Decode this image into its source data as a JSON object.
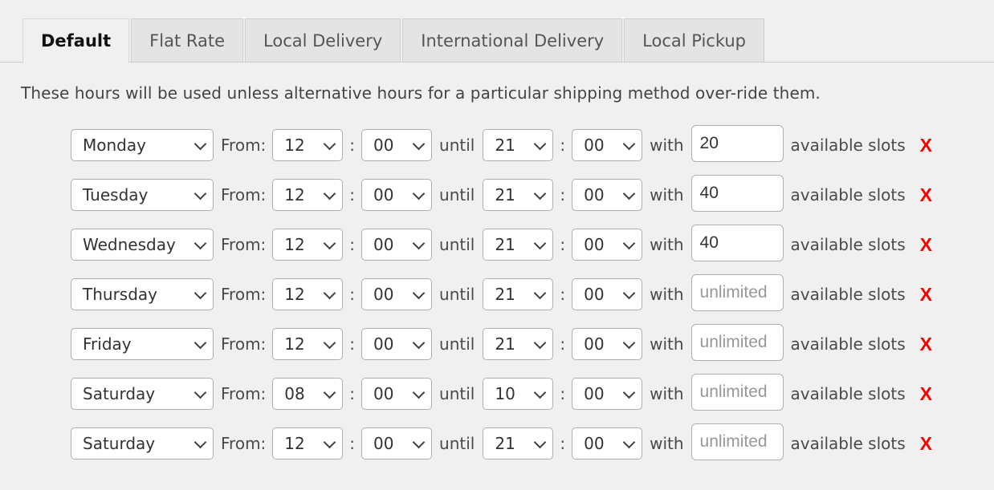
{
  "tabs": [
    {
      "label": "Default",
      "active": true
    },
    {
      "label": "Flat Rate",
      "active": false
    },
    {
      "label": "Local Delivery",
      "active": false
    },
    {
      "label": "International Delivery",
      "active": false
    },
    {
      "label": "Local Pickup",
      "active": false
    }
  ],
  "description": "These hours will be used unless alternative hours for a particular shipping method over-ride them.",
  "labels": {
    "from": "From:",
    "colon": ":",
    "until": "until",
    "with": "with",
    "available_slots": "available slots",
    "remove": "X"
  },
  "slots_placeholder": "unlimited",
  "colors": {
    "remove": "#fb0000",
    "page_bg": "#f0f0f0",
    "tab_inactive_bg": "#e4e4e4",
    "control_border": "#a9b0b7"
  },
  "rows": [
    {
      "day": "Monday",
      "from_hour": "12",
      "from_min": "00",
      "until_hour": "21",
      "until_min": "00",
      "slots": "20"
    },
    {
      "day": "Tuesday",
      "from_hour": "12",
      "from_min": "00",
      "until_hour": "21",
      "until_min": "00",
      "slots": "40"
    },
    {
      "day": "Wednesday",
      "from_hour": "12",
      "from_min": "00",
      "until_hour": "21",
      "until_min": "00",
      "slots": "40"
    },
    {
      "day": "Thursday",
      "from_hour": "12",
      "from_min": "00",
      "until_hour": "21",
      "until_min": "00",
      "slots": ""
    },
    {
      "day": "Friday",
      "from_hour": "12",
      "from_min": "00",
      "until_hour": "21",
      "until_min": "00",
      "slots": ""
    },
    {
      "day": "Saturday",
      "from_hour": "08",
      "from_min": "00",
      "until_hour": "10",
      "until_min": "00",
      "slots": ""
    },
    {
      "day": "Saturday",
      "from_hour": "12",
      "from_min": "00",
      "until_hour": "21",
      "until_min": "00",
      "slots": ""
    }
  ]
}
